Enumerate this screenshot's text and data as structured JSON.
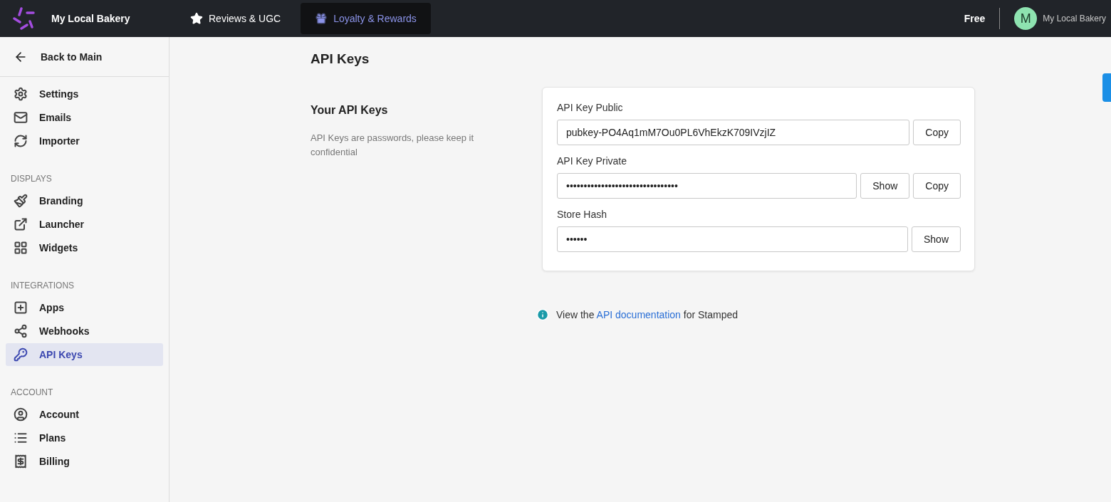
{
  "topbar": {
    "brand": "My Local Bakery",
    "tabs": [
      {
        "label": "Reviews & UGC",
        "selected": false
      },
      {
        "label": "Loyalty & Rewards",
        "selected": true
      }
    ],
    "plan": "Free",
    "avatar_letter": "M",
    "account": "My Local Bakery"
  },
  "sidebar": {
    "back": "Back to Main",
    "groups": [
      {
        "items": [
          {
            "label": "Settings",
            "selected": false
          },
          {
            "label": "Emails",
            "selected": false
          },
          {
            "label": "Importer",
            "selected": false
          }
        ]
      },
      {
        "heading": "DISPLAYS",
        "items": [
          {
            "label": "Branding",
            "selected": false
          },
          {
            "label": "Launcher",
            "selected": false
          },
          {
            "label": "Widgets",
            "selected": false
          }
        ]
      },
      {
        "heading": "INTEGRATIONS",
        "items": [
          {
            "label": "Apps",
            "selected": false
          },
          {
            "label": "Webhooks",
            "selected": false
          },
          {
            "label": "API Keys",
            "selected": true
          }
        ]
      },
      {
        "heading": "ACCOUNT",
        "items": [
          {
            "label": "Account",
            "selected": false
          },
          {
            "label": "Plans",
            "selected": false
          },
          {
            "label": "Billing",
            "selected": false
          }
        ]
      }
    ]
  },
  "page": {
    "title": "API Keys",
    "section_title": "Your API Keys",
    "section_description": "API Keys are passwords, please keep it confidential",
    "fields": [
      {
        "label": "API Key Public",
        "value": "pubkey-PO4Aq1mM7Ou0PL6VhEkzK709IVzjIZ",
        "buttons": [
          "Copy"
        ]
      },
      {
        "label": "API Key Private",
        "value": "••••••••••••••••••••••••••••••••",
        "buttons": [
          "Show",
          "Copy"
        ]
      },
      {
        "label": "Store Hash",
        "value": "••••••",
        "buttons": [
          "Show"
        ]
      }
    ],
    "note": {
      "before": "View the",
      "link": "API documentation",
      "after": "for Stamped"
    }
  }
}
